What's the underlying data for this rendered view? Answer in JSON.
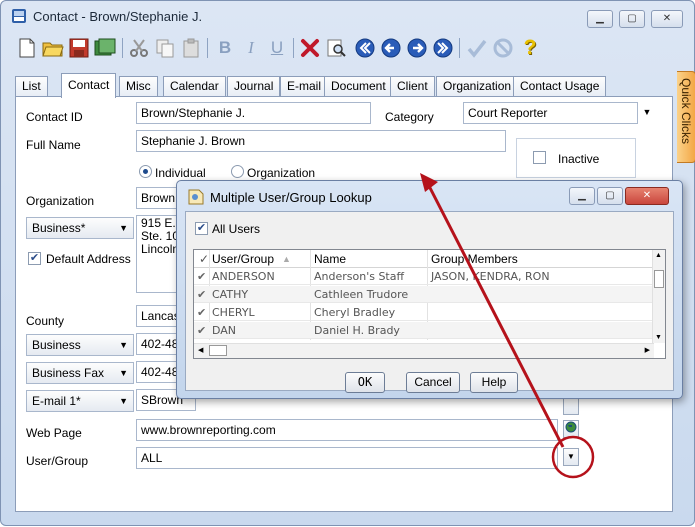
{
  "window": {
    "title": "Contact - Brown/Stephanie J.",
    "controls": [
      "minimize",
      "maximize",
      "close"
    ]
  },
  "toolbar": {
    "icons": [
      "new-icon",
      "open-icon",
      "save-icon",
      "save-close-icon",
      "cut-icon",
      "copy-icon",
      "paste-icon",
      "bold-icon",
      "italic-icon",
      "underline-icon",
      "delete-icon",
      "find-icon",
      "first-icon",
      "previous-icon",
      "next-icon",
      "last-icon",
      "check-icon",
      "cancel-icon",
      "help-icon"
    ],
    "bold": "B",
    "italic": "I",
    "underline": "U",
    "help": "?"
  },
  "tabs": [
    "List",
    "Contact",
    "Misc",
    "Calendar",
    "Journal",
    "E-mail",
    "Document",
    "Client",
    "Organization",
    "Contact Usage"
  ],
  "active_tab": "Contact",
  "quick_clicks": "Quick Clicks",
  "form": {
    "contact_id_label": "Contact ID",
    "contact_id": "Brown/Stephanie J.",
    "category_label": "Category",
    "category": "Court Reporter",
    "full_name_label": "Full Name",
    "full_name": "Stephanie J. Brown",
    "inactive_label": "Inactive",
    "individual_label": "Individual",
    "organization_radio_label": "Organization",
    "organization_label": "Organization",
    "organization": "Brown",
    "address_type": "Business*",
    "address_line1": "915 E.",
    "address_line2": "Ste. 10",
    "address_line3": "Lincoln",
    "default_address_label": "Default Address",
    "county_label": "County",
    "county": "Lancas",
    "phone_type": "Business",
    "phone": "402-48",
    "fax_type": "Business Fax",
    "fax": "402-48",
    "email_type": "E-mail 1*",
    "email": "SBrown",
    "web_page_label": "Web Page",
    "web_page": "www.brownreporting.com",
    "user_group_label": "User/Group",
    "user_group": "ALL"
  },
  "dialog": {
    "title": "Multiple User/Group Lookup",
    "all_users_label": "All Users",
    "columns": [
      "User/Group",
      "Name",
      "Group Members"
    ],
    "rows": [
      {
        "user": "ANDERSON",
        "name": "Anderson's Staff",
        "members": "JASON, KENDRA, RON"
      },
      {
        "user": "CATHY",
        "name": "Cathleen Trudore",
        "members": ""
      },
      {
        "user": "CHERYL",
        "name": "Cheryl Bradley",
        "members": ""
      },
      {
        "user": "DAN",
        "name": "Daniel H. Brady",
        "members": ""
      }
    ],
    "ok_label": "OK",
    "cancel_label": "Cancel",
    "help_label": "Help"
  },
  "colors": {
    "window_bg": "#c9d9ee",
    "callout_red": "#b5121b",
    "dialog_close_red": "#c9463d"
  }
}
